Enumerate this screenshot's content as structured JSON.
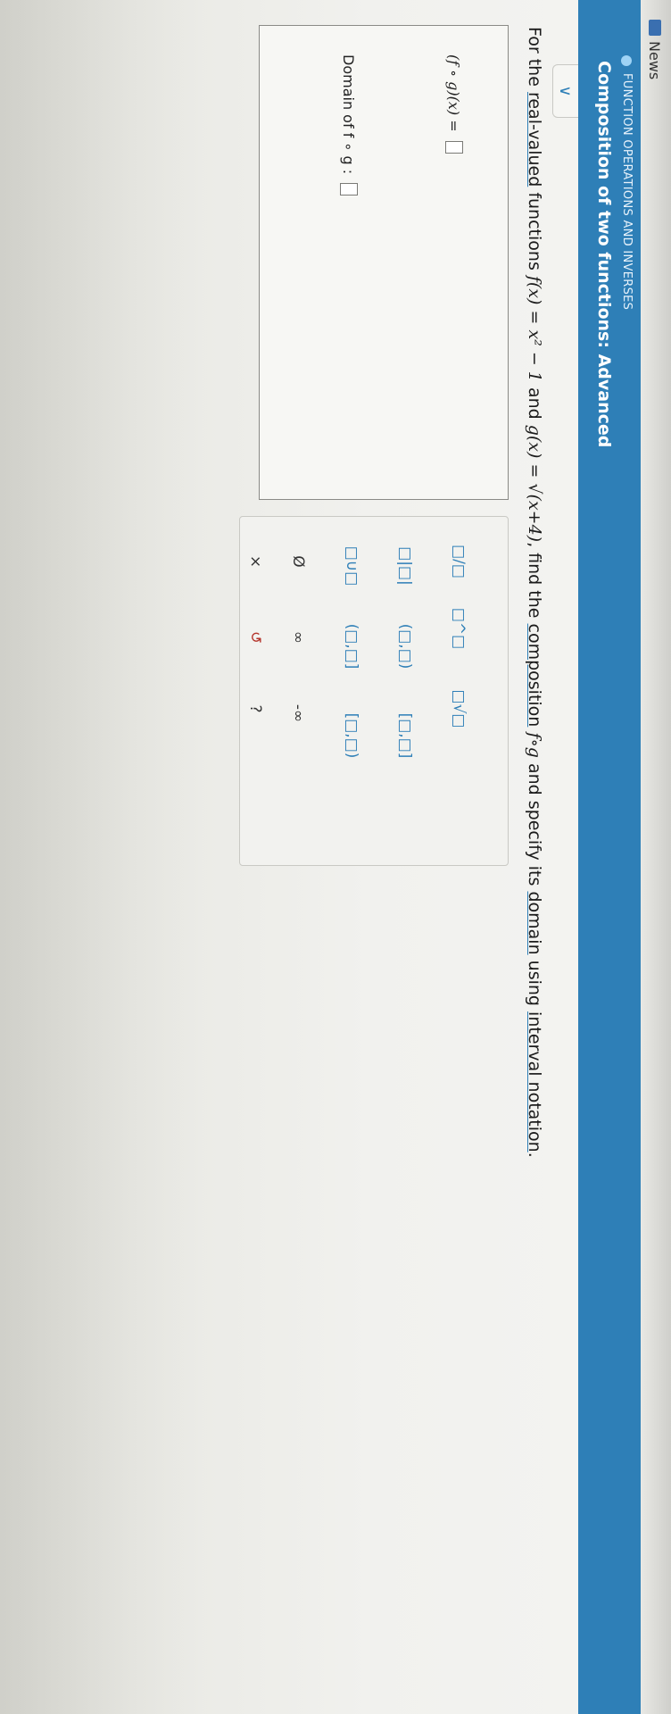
{
  "browser": {
    "tab_label": "News"
  },
  "header": {
    "section": "FUNCTION OPERATIONS AND INVERSES",
    "title": "Composition of two functions: Advanced"
  },
  "problem": {
    "prefix": "For the",
    "real_valued": "real-valued",
    "functions_text": "functions",
    "f_def": "f(x) = x² − 1",
    "and1": "and",
    "g_def": "g(x) = √(x+4)",
    "find_the": ", find the",
    "composition": "composition",
    "fog": "f∘g",
    "and_specify": "and specify its",
    "domain": "domain",
    "using": "using",
    "interval_notation": "interval notation",
    "end": "."
  },
  "answer": {
    "fog_label": "(f ∘ g)(x) =",
    "domain_label": "Domain of f ∘ g :",
    "fog_value": "",
    "domain_value": ""
  },
  "keypad": {
    "frac": "□/□",
    "pow": "□^□",
    "nroot": "□√□",
    "abs": "□|□|",
    "open_interval": "(□,□)",
    "closed_interval": "[□,□]",
    "union": "□∪□",
    "half_open_right": "(□,□]",
    "half_open_left": "[□,□)",
    "empty_set": "Ø",
    "infinity": "∞",
    "neg_infinity": "-∞",
    "clear": "×",
    "undo": "↺",
    "help": "?"
  },
  "colors": {
    "header_blue": "#2e7fb7",
    "clear_red": "#b4342b"
  }
}
